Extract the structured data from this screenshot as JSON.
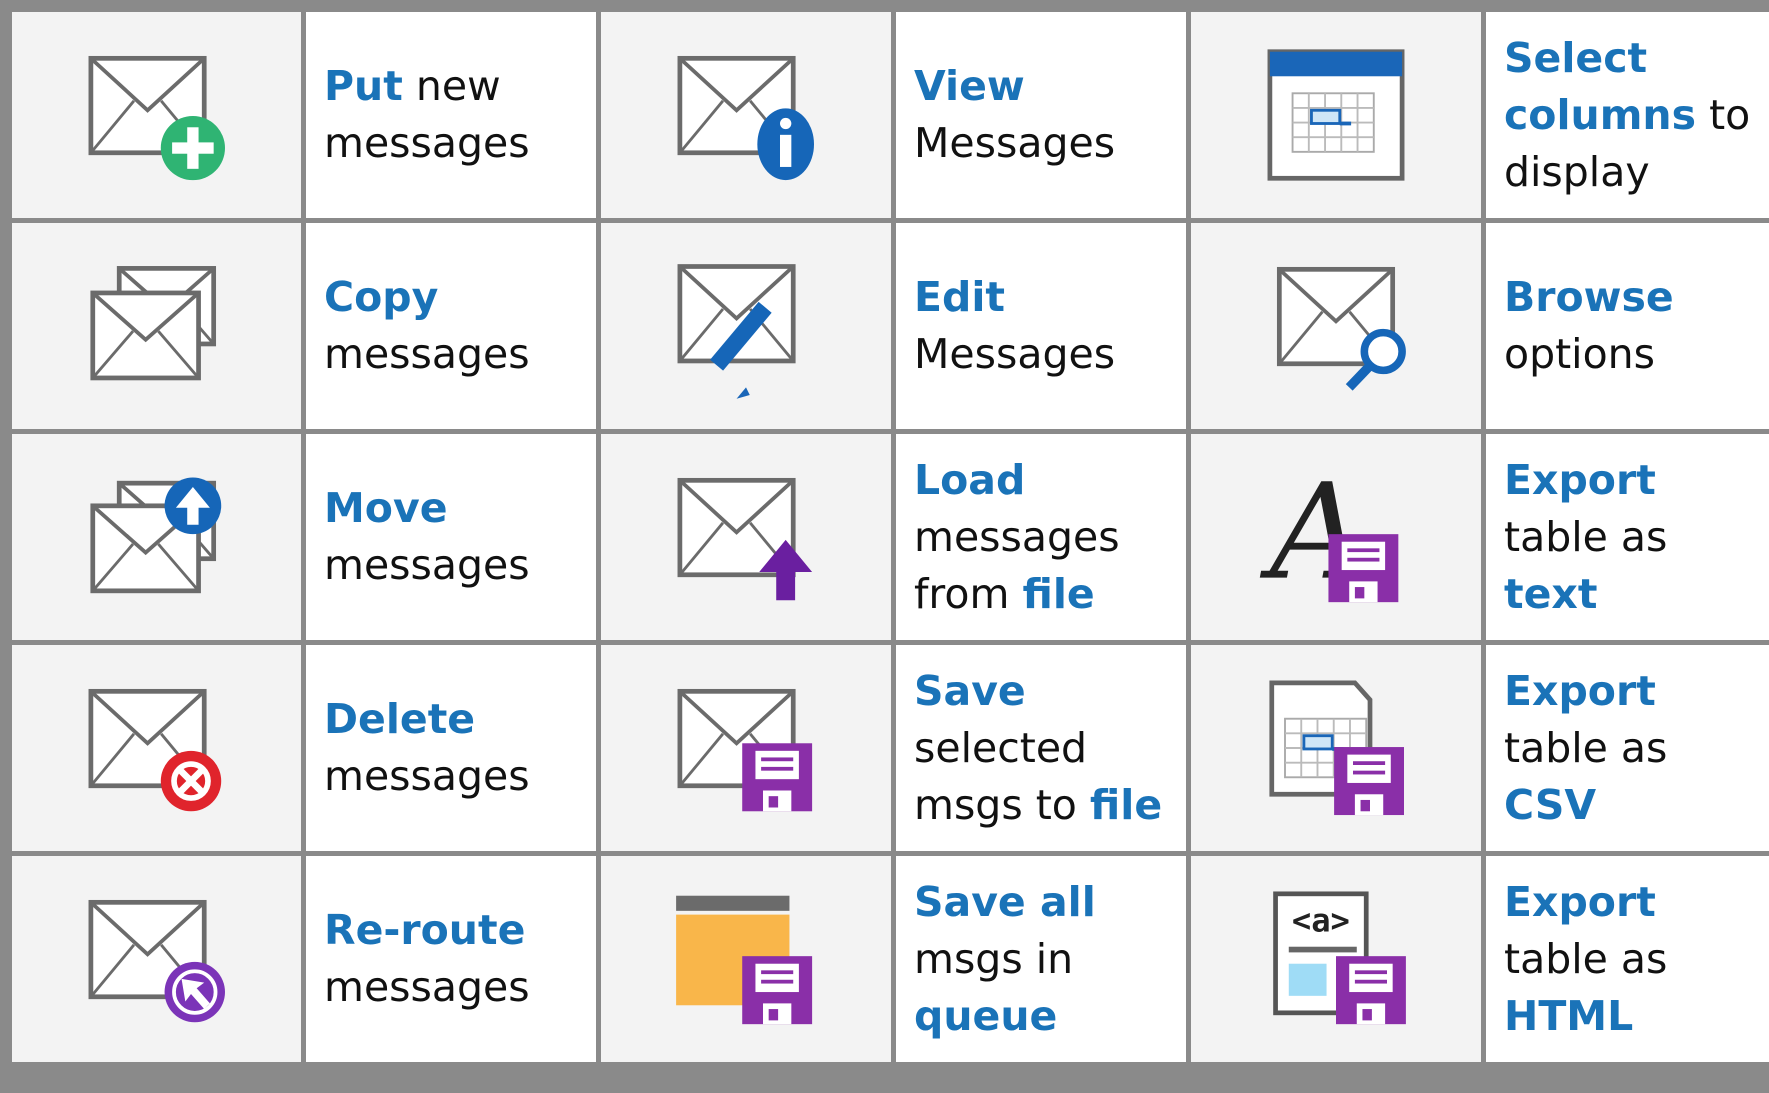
{
  "colors": {
    "accent_text": "#1a73b8",
    "add_green": "#2fb473",
    "info_blue": "#1666b8",
    "delete_red": "#e0242c",
    "reroute_purple": "#7b34b8",
    "floppy_purple": "#8a2fa8",
    "folder_orange": "#f9b64a"
  },
  "cells": [
    {
      "icon": "envelope-plus-icon",
      "parts": [
        {
          "t": "Put",
          "hl": true
        },
        {
          "t": " new messages",
          "hl": false
        }
      ]
    },
    {
      "icon": "envelope-info-icon",
      "parts": [
        {
          "t": "View",
          "hl": true
        },
        {
          "t": " Messages",
          "hl": false
        }
      ]
    },
    {
      "icon": "table-columns-icon",
      "parts": [
        {
          "t": "Select columns",
          "hl": true
        },
        {
          "t": " to display",
          "hl": false
        }
      ]
    },
    {
      "icon": "envelopes-copy-icon",
      "parts": [
        {
          "t": "Copy",
          "hl": true
        },
        {
          "t": " messages",
          "hl": false
        }
      ]
    },
    {
      "icon": "envelope-pencil-icon",
      "parts": [
        {
          "t": "Edit",
          "hl": true
        },
        {
          "t": " Messages",
          "hl": false
        }
      ]
    },
    {
      "icon": "envelope-search-icon",
      "parts": [
        {
          "t": "Browse",
          "hl": true
        },
        {
          "t": " options",
          "hl": false
        }
      ]
    },
    {
      "icon": "envelopes-move-icon",
      "parts": [
        {
          "t": "Move",
          "hl": true
        },
        {
          "t": " messages",
          "hl": false
        }
      ]
    },
    {
      "icon": "envelope-upload-icon",
      "parts": [
        {
          "t": "Load",
          "hl": true
        },
        {
          "t": " messages from ",
          "hl": false
        },
        {
          "t": "file",
          "hl": true
        }
      ]
    },
    {
      "icon": "font-floppy-icon",
      "parts": [
        {
          "t": "Export",
          "hl": true
        },
        {
          "t": " table as ",
          "hl": false
        },
        {
          "t": "text",
          "hl": true
        }
      ]
    },
    {
      "icon": "envelope-delete-icon",
      "parts": [
        {
          "t": "Delete",
          "hl": true
        },
        {
          "t": " messages",
          "hl": false
        }
      ]
    },
    {
      "icon": "envelope-floppy-icon",
      "parts": [
        {
          "t": "Save",
          "hl": true
        },
        {
          "t": " selected msgs to ",
          "hl": false
        },
        {
          "t": "file",
          "hl": true
        }
      ]
    },
    {
      "icon": "table-doc-floppy-icon",
      "parts": [
        {
          "t": "Export",
          "hl": true
        },
        {
          "t": " table as ",
          "hl": false
        },
        {
          "t": "CSV",
          "hl": true
        }
      ]
    },
    {
      "icon": "envelope-reroute-icon",
      "parts": [
        {
          "t": "Re-route",
          "hl": true
        },
        {
          "t": " messages",
          "hl": false
        }
      ]
    },
    {
      "icon": "folder-floppy-icon",
      "parts": [
        {
          "t": "Save all",
          "hl": true
        },
        {
          "t": " msgs in ",
          "hl": false
        },
        {
          "t": "queue",
          "hl": true
        }
      ]
    },
    {
      "icon": "html-doc-floppy-icon",
      "parts": [
        {
          "t": "Export",
          "hl": true
        },
        {
          "t": " table as ",
          "hl": false
        },
        {
          "t": "HTML",
          "hl": true
        }
      ]
    }
  ]
}
